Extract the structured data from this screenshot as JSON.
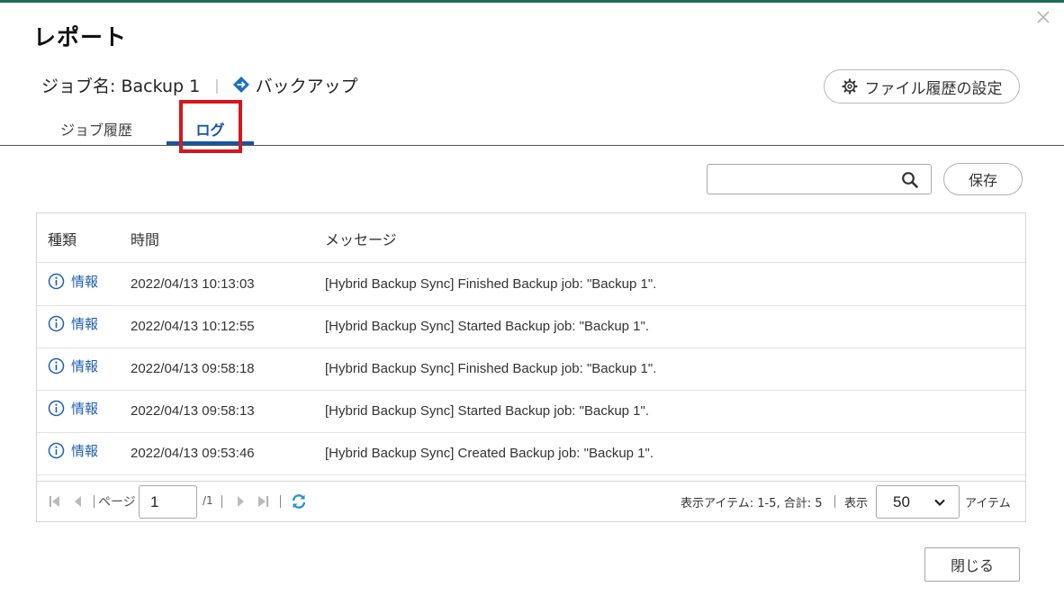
{
  "dialog": {
    "title": "レポート",
    "close_icon": "close-icon"
  },
  "job": {
    "name_label": "ジョブ名: Backup 1",
    "type_icon": "diamond-arrow-icon",
    "type_label": "バックアップ",
    "file_history_button": "ファイル履歴の設定"
  },
  "tabs": [
    {
      "label": "ジョブ履歴",
      "active": false
    },
    {
      "label": "ログ",
      "active": true
    }
  ],
  "toolbar": {
    "search_value": "",
    "save_label": "保存"
  },
  "table": {
    "headers": {
      "type": "種類",
      "time": "時間",
      "message": "メッセージ"
    },
    "rows": [
      {
        "type": "情報",
        "time": "2022/04/13 10:13:03",
        "message": "[Hybrid Backup Sync] Finished Backup job: \"Backup 1\"."
      },
      {
        "type": "情報",
        "time": "2022/04/13 10:12:55",
        "message": "[Hybrid Backup Sync] Started Backup job: \"Backup 1\"."
      },
      {
        "type": "情報",
        "time": "2022/04/13 09:58:18",
        "message": "[Hybrid Backup Sync] Finished Backup job: \"Backup 1\"."
      },
      {
        "type": "情報",
        "time": "2022/04/13 09:58:13",
        "message": "[Hybrid Backup Sync] Started Backup job: \"Backup 1\"."
      },
      {
        "type": "情報",
        "time": "2022/04/13 09:53:46",
        "message": "[Hybrid Backup Sync] Created Backup job: \"Backup 1\"."
      }
    ]
  },
  "pager": {
    "page_label": "ページ",
    "page_value": "1",
    "total_pages": "/1",
    "items_info": "表示アイテム: 1-5, 合計: 5",
    "show_label": "表示",
    "per_page_value": "50",
    "items_label": "アイテム"
  },
  "footer": {
    "close_label": "閉じる"
  },
  "colors": {
    "accent": "#1454a8",
    "highlight_box": "#d6161e",
    "top_bar": "#1f6b5a"
  }
}
